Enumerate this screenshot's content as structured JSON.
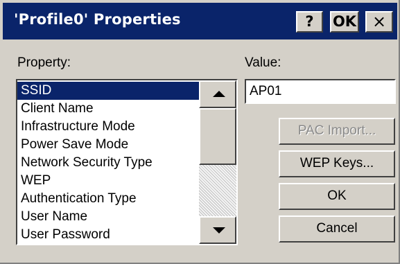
{
  "window": {
    "title": "'Profile0' Properties",
    "help_label": "?",
    "ok_label": "OK",
    "close_label": "×"
  },
  "property_label": "Property:",
  "value_label": "Value:",
  "properties": [
    "SSID",
    "Client Name",
    "Infrastructure Mode",
    "Power Save Mode",
    "Network Security Type",
    "WEP",
    "Authentication Type",
    "User Name",
    "User Password"
  ],
  "selected_property": "SSID",
  "value": "AP01",
  "buttons": {
    "pac_import": "PAC Import...",
    "wep_keys": "WEP Keys...",
    "ok": "OK",
    "cancel": "Cancel"
  },
  "colors": {
    "titlebar": "#0a246a",
    "selection": "#0a246a",
    "face": "#d4d0c8"
  }
}
